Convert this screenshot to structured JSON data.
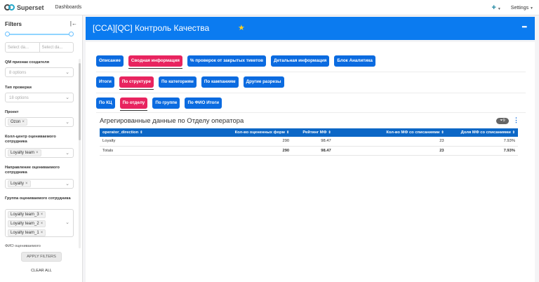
{
  "nav": {
    "brand": "Superset",
    "dashboards": "Dashboards",
    "plus": "+",
    "settings": "Settings"
  },
  "filters": {
    "title": "Filters",
    "date_placeholders": [
      "Select da...",
      "Select da..."
    ],
    "items": [
      {
        "label": "QM признак создателя",
        "placeholder": "8 options",
        "tags": []
      },
      {
        "label": "Тип проверки",
        "placeholder": "18 options",
        "tags": []
      },
      {
        "label": "Проект",
        "placeholder": "",
        "tags": [
          "Ozon"
        ]
      },
      {
        "label": "Колл-центр оцениваемого сотрудника",
        "placeholder": "",
        "tags": [
          "Loyalty team"
        ]
      },
      {
        "label": "Направление оцениваемого сотрудника",
        "placeholder": "",
        "tags": [
          "Loyalty"
        ]
      },
      {
        "label": "Группа оцениваемого сотрудника",
        "placeholder": "",
        "tags": [
          "Loyalty team_3",
          "Loyalty team_2",
          "Loyalty team_1"
        ]
      },
      {
        "label": "ФИО оцениваемого",
        "placeholder": "",
        "tags": []
      }
    ],
    "apply": "APPLY FILTERS",
    "clear": "CLEAR ALL"
  },
  "dashboard": {
    "title": "[CCA][QC] Контроль Качества",
    "more": "•••"
  },
  "tabs_level1": [
    {
      "label": "Описание",
      "active": false
    },
    {
      "label": "Сводная информация",
      "active": true
    },
    {
      "label": "% проверок от закрытых тикетов",
      "active": false
    },
    {
      "label": "Детальная информация",
      "active": false
    },
    {
      "label": "Блок Аналитика",
      "active": false
    }
  ],
  "tabs_level2": [
    {
      "label": "Итоги",
      "active": false
    },
    {
      "label": "По структуре",
      "active": true
    },
    {
      "label": "По категориям",
      "active": false
    },
    {
      "label": "По кампаниям",
      "active": false
    },
    {
      "label": "Другие разрезы",
      "active": false
    }
  ],
  "tabs_level3": [
    {
      "label": "По КЦ",
      "active": false
    },
    {
      "label": "По отделу",
      "active": true
    },
    {
      "label": "По группе",
      "active": false
    },
    {
      "label": "По ФИО Итоги",
      "active": false
    }
  ],
  "chart": {
    "title": "Агрегированные данные по Отделу оператора",
    "badge": "9",
    "columns": [
      "operator_direction",
      "Кол-во оцененных форм",
      "Рейтинг МФ",
      "Кол-во МФ со списаниями",
      "Доля МФ со списаниями"
    ],
    "rows": [
      [
        "Loyalty",
        "290",
        "98.47",
        "23",
        "7.93%"
      ]
    ],
    "totals": [
      "Totals",
      "290",
      "98.47",
      "23",
      "7.93%"
    ]
  }
}
